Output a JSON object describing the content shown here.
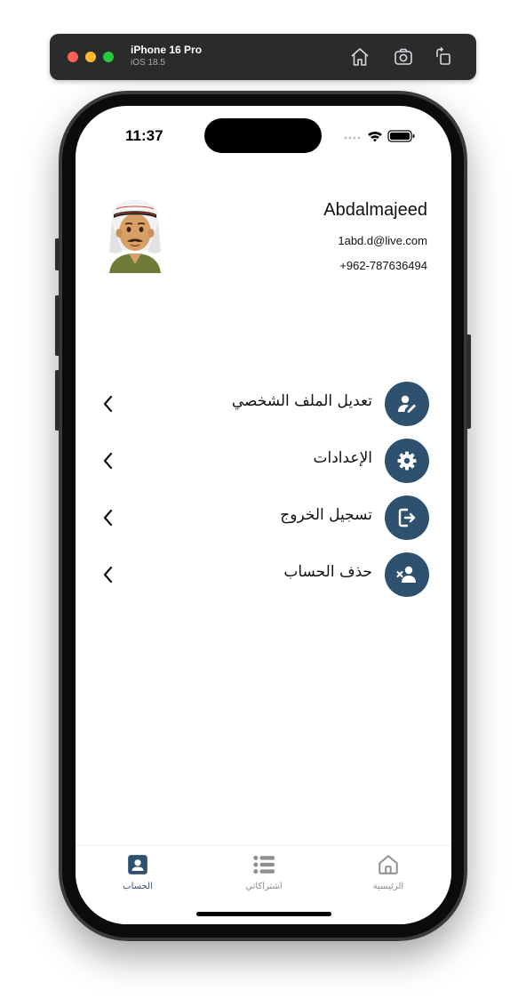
{
  "simulator": {
    "device_name": "iPhone 16 Pro",
    "os_version": "iOS 18.5"
  },
  "status_bar": {
    "time": "11:37"
  },
  "profile": {
    "name": "Abdalmajeed",
    "email": "1abd.d@live.com",
    "phone": "+962-787636494",
    "avatar_icon": "arab-man-emoji-avatar"
  },
  "menu": [
    {
      "label": "تعديل الملف الشخصي",
      "icon": "user-pen-icon"
    },
    {
      "label": "الإعدادات",
      "icon": "gear-icon"
    },
    {
      "label": "تسجيل الخروج",
      "icon": "logout-icon"
    },
    {
      "label": "حذف الحساب",
      "icon": "user-xmark-icon"
    }
  ],
  "tabs": {
    "account": {
      "label": "الحساب",
      "icon": "id-card-icon",
      "active": true
    },
    "subscriptions": {
      "label": "اشتراكاتي",
      "icon": "list-icon",
      "active": false
    },
    "home": {
      "label": "الرئيسية",
      "icon": "home-icon",
      "active": false
    }
  },
  "colors": {
    "accent": "#2e5170",
    "inactive_tab": "#8e8e93"
  }
}
